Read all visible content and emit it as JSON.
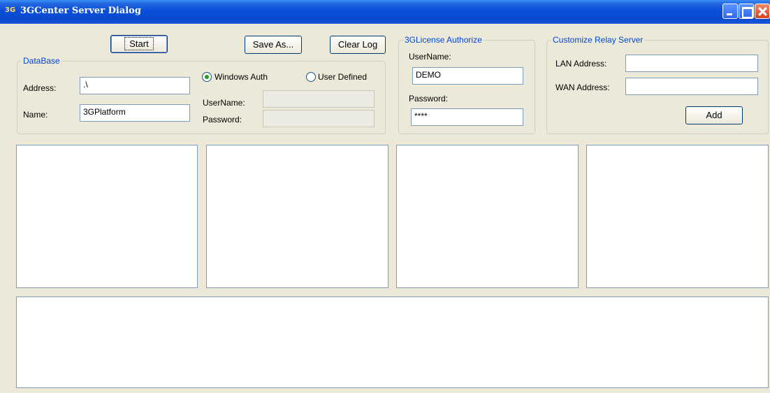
{
  "window": {
    "title": "3GCenter Server Dialog",
    "icon_text": "3G",
    "icon": "app-3g-icon"
  },
  "toolbar": {
    "start_label": "Start",
    "save_as_label": "Save As...",
    "clear_log_label": "Clear Log"
  },
  "database": {
    "legend": "DataBase",
    "address_label": "Address:",
    "address_value": ".\\",
    "name_label": "Name:",
    "name_value": "3GPlatform",
    "windows_auth_label": "Windows Auth",
    "user_defined_label": "User Defined",
    "auth_selected": "Windows Auth",
    "username_label": "UserName:",
    "username_value": "",
    "password_label": "Password:",
    "password_value": ""
  },
  "license": {
    "legend": "3GLicense Authorize",
    "username_label": "UserName:",
    "username_value": "DEMO",
    "password_label": "Password:",
    "password_value": "****"
  },
  "relay": {
    "legend": "Customize Relay Server",
    "lan_label": "LAN Address:",
    "lan_value": "",
    "wan_label": "WAN Address:",
    "wan_value": "",
    "add_label": "Add"
  },
  "colors": {
    "titlebar": "#0a4fd8",
    "legend_text": "#0046d5",
    "dialog_bg": "#ece9d8",
    "radio_dot": "#21a121"
  }
}
